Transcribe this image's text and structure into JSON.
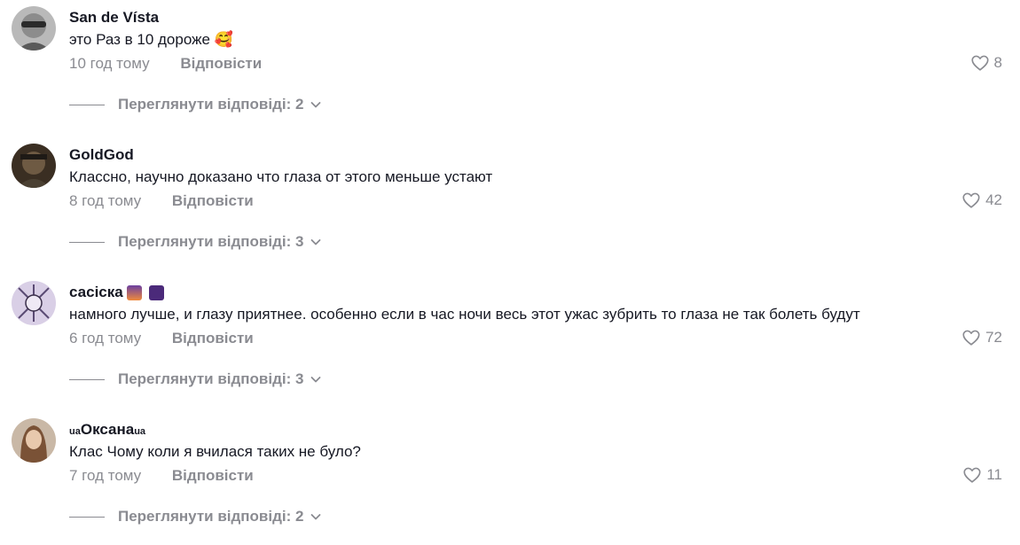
{
  "comments": [
    {
      "username": "San de Vísta",
      "text": "это Раз в 10 дороже 🥰",
      "time": "10 год тому",
      "reply_label": "Відповісти",
      "likes": "8",
      "view_replies": "Переглянути відповіді: 2"
    },
    {
      "username": "GoldGod",
      "text": "Классно, научно доказано что глаза от этого меньше устают",
      "time": "8 год тому",
      "reply_label": "Відповісти",
      "likes": "42",
      "view_replies": "Переглянути відповіді: 3"
    },
    {
      "username": "сасіска",
      "text": "намного лучше, и глазу приятнее. особенно если в час ночи весь этот ужас зубрить то глаза не так болеть будут",
      "time": "6 год тому",
      "reply_label": "Відповісти",
      "likes": "72",
      "view_replies": "Переглянути відповіді: 3"
    },
    {
      "username_prefix": "ua",
      "username": "Оксана",
      "username_suffix": "ua",
      "text": "Клас Чому коли я вчилася таких не було?",
      "time": "7 год тому",
      "reply_label": "Відповісти",
      "likes": "11",
      "view_replies": "Переглянути відповіді: 2"
    }
  ],
  "icons": {
    "like": "heart-outline-icon",
    "expand": "chevron-down-icon"
  },
  "colors": {
    "text": "#161823",
    "muted": "#8a8b91"
  }
}
